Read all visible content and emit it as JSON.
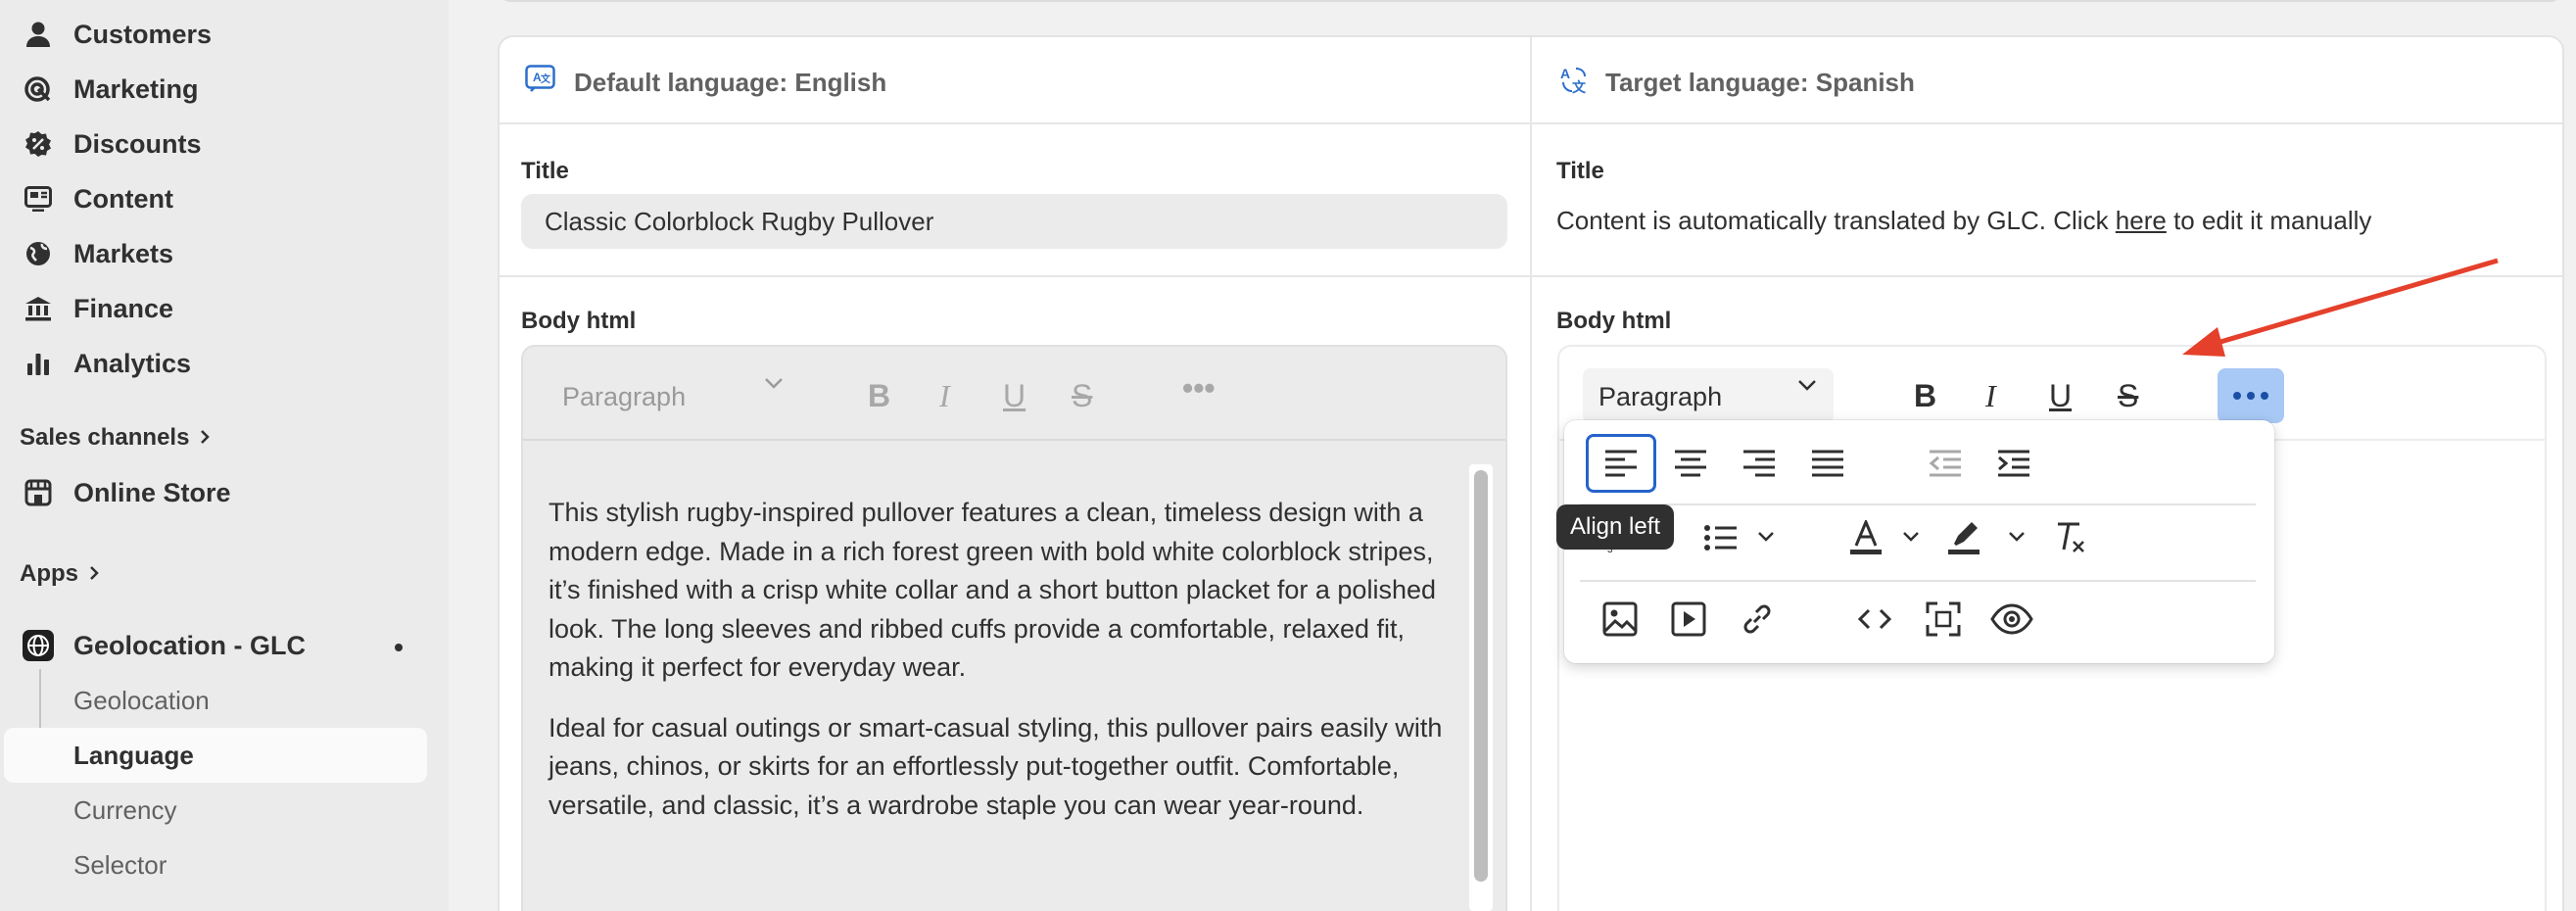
{
  "sidebar": {
    "items": [
      {
        "label": "Customers",
        "icon": "person-icon"
      },
      {
        "label": "Marketing",
        "icon": "target-icon"
      },
      {
        "label": "Discounts",
        "icon": "discount-icon"
      },
      {
        "label": "Content",
        "icon": "content-icon"
      },
      {
        "label": "Markets",
        "icon": "globe-icon"
      },
      {
        "label": "Finance",
        "icon": "bank-icon"
      },
      {
        "label": "Analytics",
        "icon": "bar-chart-icon"
      }
    ],
    "sales_channels_label": "Sales channels",
    "online_store_label": "Online Store",
    "apps_label": "Apps",
    "app_name": "Geolocation - GLC",
    "app_subitems": [
      {
        "label": "Geolocation"
      },
      {
        "label": "Language"
      },
      {
        "label": "Currency"
      },
      {
        "label": "Selector"
      }
    ]
  },
  "main": {
    "default_language_label": "Default language: English",
    "target_language_label": "Target language: Spanish",
    "left": {
      "title_label": "Title",
      "title_value": "Classic Colorblock Rugby Pullover",
      "body_label": "Body html",
      "paragraph_select": "Paragraph",
      "body_paragraphs": [
        "This stylish rugby-inspired pullover features a clean, timeless design with a modern edge. Made in a rich forest green with bold white colorblock stripes, it’s finished with a crisp white collar and a short button placket for a polished look. The long sleeves and ribbed cuffs provide a comfortable, relaxed fit, making it perfect for everyday wear.",
        "Ideal for casual outings or smart-casual styling, this pullover pairs easily with jeans, chinos, or skirts for an effortlessly put-together outfit. Comfortable, versatile, and classic, it’s a wardrobe staple you can wear year-round."
      ]
    },
    "right": {
      "title_label": "Title",
      "auto_text_before": "Content is automatically translated by GLC. Click ",
      "auto_text_link": "here",
      "auto_text_after": " to edit it manually",
      "body_label": "Body html",
      "paragraph_select": "Paragraph"
    },
    "tooltip": "Align left"
  },
  "colors": {
    "accent_blue": "#2563c9",
    "more_button_bg": "#a8c8f5",
    "annotation_arrow": "#e5402b"
  }
}
